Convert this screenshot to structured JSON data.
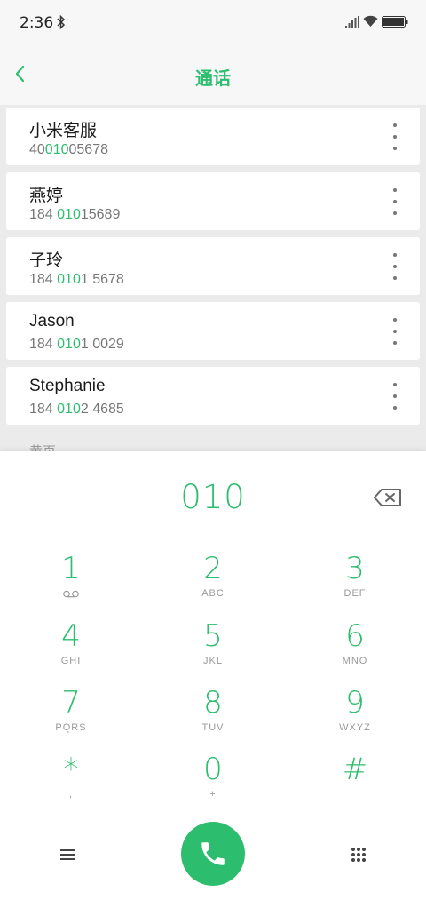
{
  "status_bar": {
    "time": "2:36",
    "icons": [
      "bluetooth-icon",
      "signal-icon",
      "wifi-icon",
      "battery-icon"
    ]
  },
  "header": {
    "title": "通话",
    "back_icon": "chevron-left-icon"
  },
  "results": [
    {
      "name": "小米客服",
      "number_pre": "40",
      "number_match": "010",
      "number_post": "05678"
    },
    {
      "name": "燕婷",
      "number_pre": "184 ",
      "number_match": "010",
      "number_post": "15689"
    },
    {
      "name": "子玲",
      "number_pre": "184 ",
      "number_match": "010",
      "number_post": "1 5678"
    },
    {
      "name": "Jason",
      "number_pre": "184 ",
      "number_match": "010",
      "number_post": "1 0029"
    },
    {
      "name": "Stephanie",
      "number_pre": "184 ",
      "number_match": "010",
      "number_post": "2 4685"
    }
  ],
  "section_peek": "黄页",
  "dialpad": {
    "input": "010",
    "keys": [
      {
        "digit": "1",
        "letters": ""
      },
      {
        "digit": "2",
        "letters": "ABC"
      },
      {
        "digit": "3",
        "letters": "DEF"
      },
      {
        "digit": "4",
        "letters": "GHI"
      },
      {
        "digit": "5",
        "letters": "JKL"
      },
      {
        "digit": "6",
        "letters": "MNO"
      },
      {
        "digit": "7",
        "letters": "PQRS"
      },
      {
        "digit": "8",
        "letters": "TUV"
      },
      {
        "digit": "9",
        "letters": "WXYZ"
      },
      {
        "digit": "*",
        "letters": ","
      },
      {
        "digit": "0",
        "letters": "+"
      },
      {
        "digit": "#",
        "letters": ""
      }
    ]
  },
  "colors": {
    "accent": "#2dbd6e",
    "list_background": "#ebebeb",
    "header_background": "#f7f7f7"
  }
}
